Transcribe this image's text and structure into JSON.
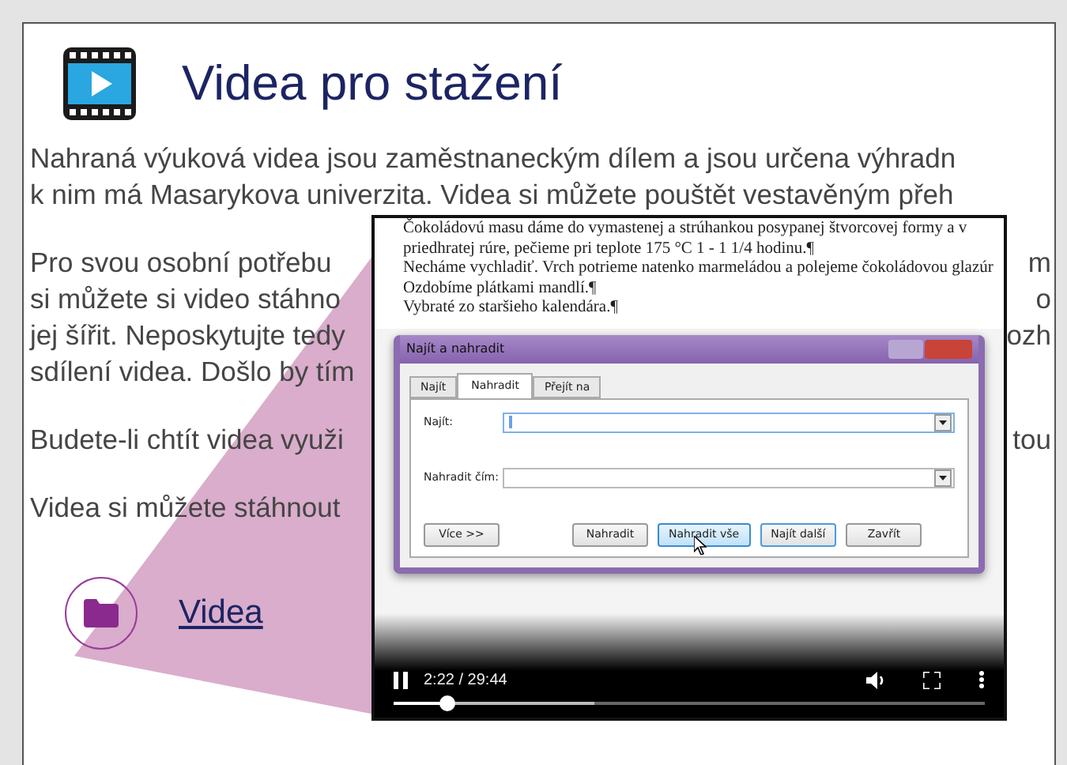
{
  "page": {
    "title": "Videa pro stažení"
  },
  "paragraphs": [
    {
      "lines": [
        {
          "text": "Nahraná výuková videa jsou zaměstnaneckým dílem a jsou určena výhradn"
        },
        {
          "text": "k nim má Masarykova univerzita. Videa si můžete pouštět vestavěným přeh"
        }
      ]
    },
    {
      "lines": [
        {
          "text": "Pro svou osobní potřebu",
          "tail": "m"
        },
        {
          "text": "si můžete si video stáhno",
          "tail": "o"
        },
        {
          "text": "jej šířit. Neposkytujte tedy",
          "tail": "ozh"
        },
        {
          "text": "sdílení videa. Došlo by tím"
        }
      ]
    },
    {
      "lines": [
        {
          "text": "Budete-li chtít videa využi",
          "tail": "tou"
        }
      ]
    },
    {
      "lines": [
        {
          "text": "Videa si můžete stáhnout"
        }
      ]
    }
  ],
  "download_link": {
    "label": "Videa"
  },
  "video": {
    "document_lines": [
      "Čokoládovú masu dáme do vymastenej a strúhankou posypanej štvorcovej formy a v",
      "priedhratej rúre, pečieme pri teplote 175 °C 1 - 1 1/4 hodinu.¶",
      "Necháme vychladiť. Vrch potrieme natenko marmeládou a polejeme čokoládovou glazúr",
      "Ozdobíme plátkami mandlí.¶",
      "Vybraté zo staršieho kalendára.¶"
    ],
    "dialog": {
      "title": "Najít a nahradit",
      "tabs": [
        {
          "label": "Najít",
          "selected": false
        },
        {
          "label": "Nahradit",
          "selected": true
        },
        {
          "label": "Přejít na",
          "selected": false
        }
      ],
      "fields": [
        {
          "label": "Najít:",
          "focused": true
        },
        {
          "label": "Nahradit čím:",
          "focused": false
        }
      ],
      "buttons": [
        {
          "label": "Více >>",
          "kind": "normal"
        },
        {
          "label": "Nahradit",
          "kind": "normal"
        },
        {
          "label": "Nahradit vše",
          "kind": "hovered"
        },
        {
          "label": "Najít další",
          "kind": "default"
        },
        {
          "label": "Zavřít",
          "kind": "normal"
        }
      ]
    },
    "time": "2:22 / 29:44",
    "buffered": {
      "level": 0.34
    },
    "progress": {
      "level": 0.09
    }
  }
}
